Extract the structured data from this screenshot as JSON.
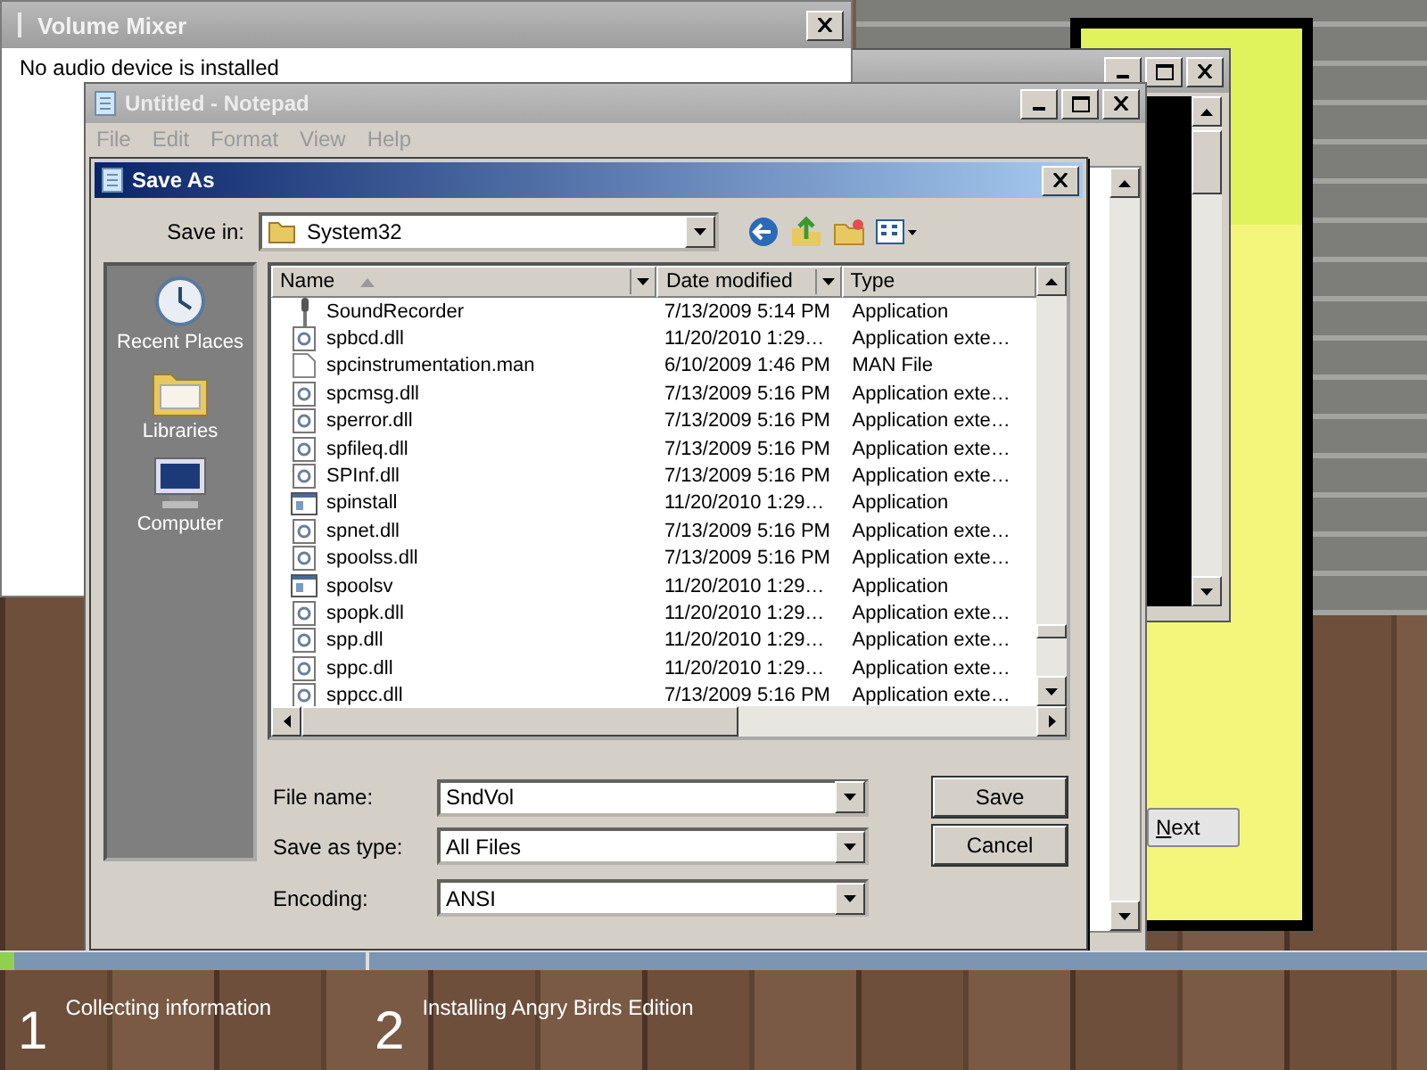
{
  "volume_mixer": {
    "title": "Volume Mixer",
    "message": "No audio device is installed"
  },
  "installer": {
    "button": "Next"
  },
  "notepad": {
    "title": "Untitled - Notepad",
    "menu": [
      "File",
      "Edit",
      "Format",
      "View",
      "Help"
    ]
  },
  "save_as": {
    "title": "Save As",
    "save_in_label": "Save in:",
    "save_in": "System32",
    "places": [
      {
        "label": "Recent Places",
        "kind": "recent"
      },
      {
        "label": "Libraries",
        "kind": "libraries"
      },
      {
        "label": "Computer",
        "kind": "computer"
      }
    ],
    "columns": [
      "Name",
      "Date modified",
      "Type"
    ],
    "rows": [
      {
        "name": "SoundRecorder",
        "date": "7/13/2009 5:14 PM",
        "type": "Application",
        "kind": "recorder"
      },
      {
        "name": "spbcd.dll",
        "date": "11/20/2010 1:29…",
        "type": "Application exte…",
        "kind": "dll"
      },
      {
        "name": "spcinstrumentation.man",
        "date": "6/10/2009 1:46 PM",
        "type": "MAN File",
        "kind": "file"
      },
      {
        "name": "spcmsg.dll",
        "date": "7/13/2009 5:16 PM",
        "type": "Application exte…",
        "kind": "dll"
      },
      {
        "name": "sperror.dll",
        "date": "7/13/2009 5:16 PM",
        "type": "Application exte…",
        "kind": "dll"
      },
      {
        "name": "spfileq.dll",
        "date": "7/13/2009 5:16 PM",
        "type": "Application exte…",
        "kind": "dll"
      },
      {
        "name": "SPInf.dll",
        "date": "7/13/2009 5:16 PM",
        "type": "Application exte…",
        "kind": "dll"
      },
      {
        "name": "spinstall",
        "date": "11/20/2010 1:29…",
        "type": "Application",
        "kind": "app"
      },
      {
        "name": "spnet.dll",
        "date": "7/13/2009 5:16 PM",
        "type": "Application exte…",
        "kind": "dll"
      },
      {
        "name": "spoolss.dll",
        "date": "7/13/2009 5:16 PM",
        "type": "Application exte…",
        "kind": "dll"
      },
      {
        "name": "spoolsv",
        "date": "11/20/2010 1:29…",
        "type": "Application",
        "kind": "app"
      },
      {
        "name": "spopk.dll",
        "date": "11/20/2010 1:29…",
        "type": "Application exte…",
        "kind": "dll"
      },
      {
        "name": "spp.dll",
        "date": "11/20/2010 1:29…",
        "type": "Application exte…",
        "kind": "dll"
      },
      {
        "name": "sppc.dll",
        "date": "11/20/2010 1:29…",
        "type": "Application exte…",
        "kind": "dll"
      },
      {
        "name": "sppcc.dll",
        "date": "7/13/2009 5:16 PM",
        "type": "Application exte…",
        "kind": "dll"
      }
    ],
    "file_name_label": "File name:",
    "file_name": "SndVol",
    "type_label": "Save as type:",
    "save_type": "All Files",
    "encoding_label": "Encoding:",
    "encoding": "ANSI",
    "buttons": [
      "Save",
      "Cancel"
    ]
  },
  "setup_steps": [
    {
      "number": "1",
      "label": "Collecting information",
      "level": 0.04
    },
    {
      "number": "2",
      "label": "Installing Angry Birds Edition"
    }
  ]
}
